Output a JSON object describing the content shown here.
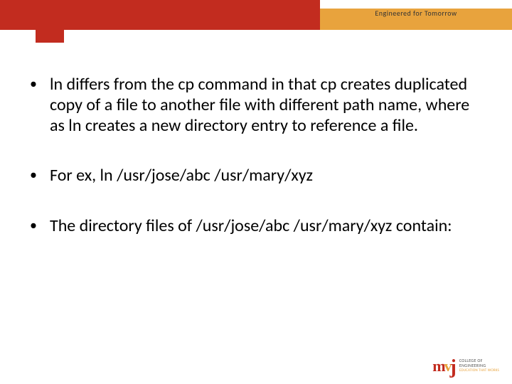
{
  "header": {
    "tagline": "Engineered for Tomorrow"
  },
  "bullets": [
    {
      "text": "ln differs from the cp command in that cp creates duplicated copy of a file to another file with different path name, where as ln creates a new directory entry to reference a file."
    },
    {
      "text": "For ex, ln /usr/jose/abc /usr/mary/xyz"
    },
    {
      "text": "The directory files of /usr/jose/abc /usr/mary/xyz contain:"
    }
  ],
  "logo": {
    "m": "m",
    "v": "v",
    "j": "j",
    "line1": "COLLEGE OF",
    "line2": "ENGINEERING",
    "sub": "EDUCATION THAT WORKS"
  }
}
